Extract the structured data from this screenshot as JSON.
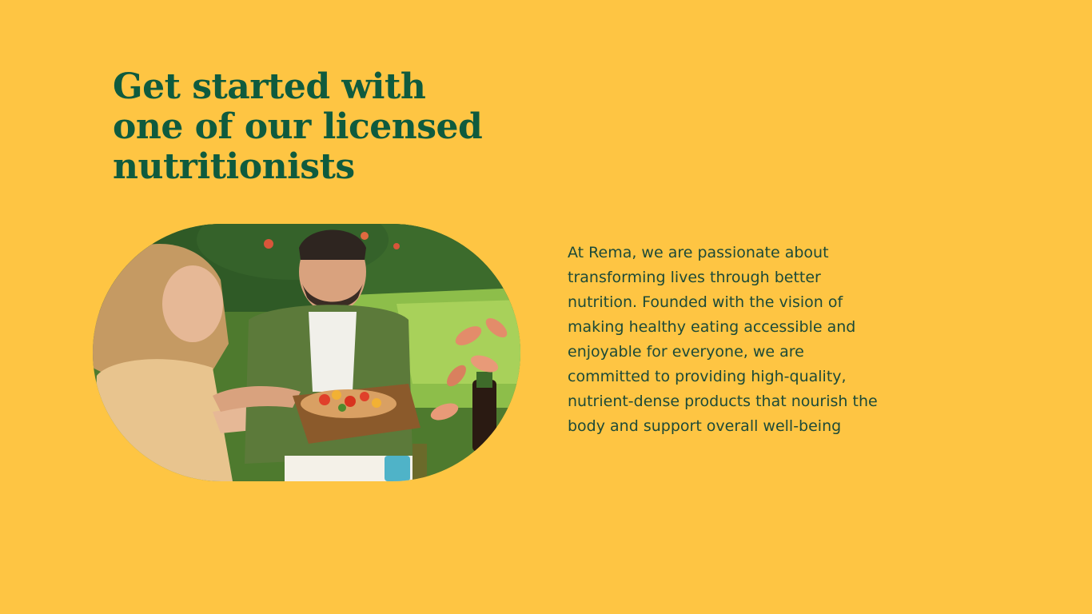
{
  "headline": {
    "line1": "Get started with",
    "line2": "one of our licensed",
    "line3": "nutritionists"
  },
  "photo": {
    "icon": "dining-photo"
  },
  "about": {
    "lines": [
      "At Rema, we are passionate about",
      "transforming lives through better",
      "nutrition. Founded with the vision of",
      "making healthy eating accessible and",
      "enjoyable for everyone, we are",
      "committed to providing high-quality,",
      "nutrient-dense products that nourish the",
      "body and support overall well-being"
    ]
  },
  "colors": {
    "background": "#FEC543",
    "headline": "#0F5B3E",
    "body": "#1C4A38"
  }
}
